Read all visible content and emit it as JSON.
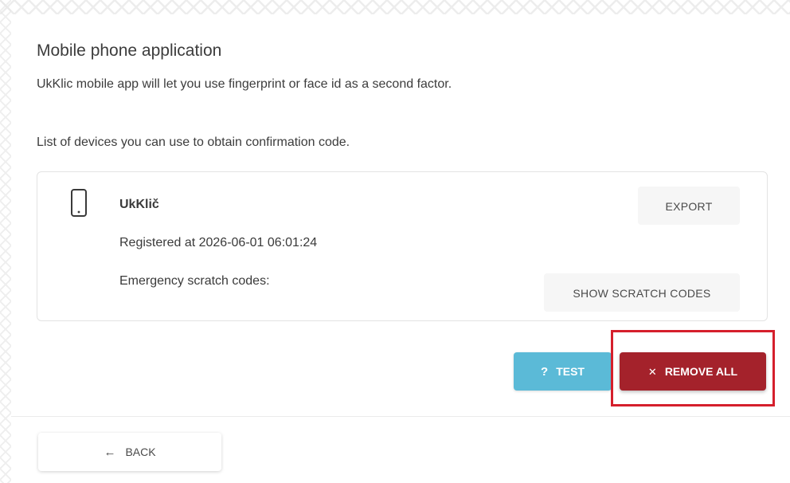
{
  "section": {
    "title": "Mobile phone application",
    "description": "UkKlic mobile app will let you use fingerprint or face id as a second factor.",
    "list_caption": "List of devices you can use to obtain confirmation code."
  },
  "device": {
    "icon": "smartphone-icon",
    "name": "UkKlič",
    "registered": "Registered at 2026-06-01 06:01:24",
    "scratch_label": "Emergency scratch codes:",
    "export_label": "EXPORT",
    "show_scratch_label": "SHOW SCRATCH CODES"
  },
  "actions": {
    "test_icon": "?",
    "test_label": "TEST",
    "test_color": "#5bbad7",
    "remove_icon": "✕",
    "remove_label": "REMOVE ALL",
    "remove_color": "#a4222b",
    "highlight_color": "#d51f2c"
  },
  "footer": {
    "back_icon": "←",
    "back_label": "BACK"
  }
}
